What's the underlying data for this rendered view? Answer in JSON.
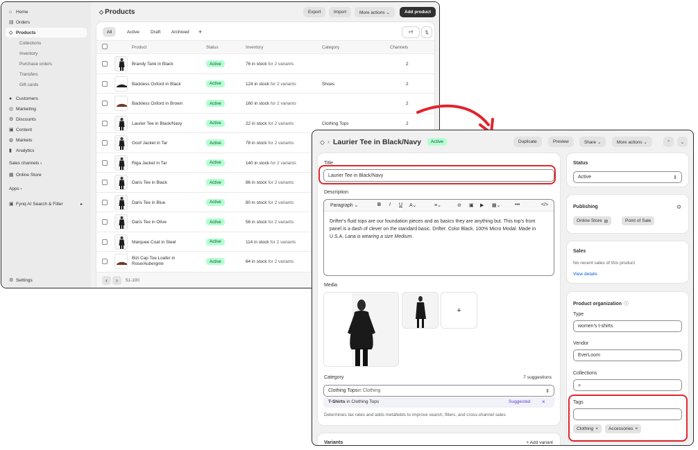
{
  "sidebar": {
    "items": [
      {
        "label": "Home",
        "icon": "home-icon",
        "glyph": "⌂"
      },
      {
        "label": "Orders",
        "icon": "orders-icon",
        "glyph": "▤"
      },
      {
        "label": "Products",
        "icon": "tag-icon",
        "glyph": "◇"
      }
    ],
    "sub_items": [
      "Collections",
      "Inventory",
      "Purchase orders",
      "Transfers",
      "Gift cards"
    ],
    "items2": [
      {
        "label": "Customers",
        "icon": "person-icon",
        "glyph": "●"
      },
      {
        "label": "Marketing",
        "icon": "target-icon",
        "glyph": "◎"
      },
      {
        "label": "Discounts",
        "icon": "discount-icon",
        "glyph": "⚙"
      },
      {
        "label": "Content",
        "icon": "content-icon",
        "glyph": "▣"
      },
      {
        "label": "Markets",
        "icon": "globe-icon",
        "glyph": "◍"
      },
      {
        "label": "Analytics",
        "icon": "analytics-icon",
        "glyph": "▮"
      }
    ],
    "sales_channels": "Sales channels ›",
    "online_store": "Online Store",
    "apps": "Apps ›",
    "app_item": "Fynq AI Search & Filter",
    "settings": "Settings"
  },
  "products_page": {
    "title": "Products",
    "buttons": {
      "export": "Export",
      "import": "Import",
      "more_actions": "More actions ⌄",
      "add_product": "Add product"
    },
    "tabs": [
      "All",
      "Active",
      "Draft",
      "Archived",
      "+"
    ],
    "columns": {
      "product": "Product",
      "status": "Status",
      "inventory": "Inventory",
      "category": "Category",
      "channels": "Channels"
    },
    "rows": [
      {
        "name": "Brandy Tank in Black",
        "status": "Active",
        "stock": "76 in stock",
        "variants": " for 2 variants",
        "category": "",
        "channels": "2"
      },
      {
        "name": "Backless Oxford in Black",
        "status": "Active",
        "stock": "124 in stock",
        "variants": " for 2 variants",
        "category": "Shoes",
        "channels": "2"
      },
      {
        "name": "Backless Oxford in Brown",
        "status": "Active",
        "stock": "160 in stock",
        "variants": " for 2 variants",
        "category": "",
        "channels": "2"
      },
      {
        "name": "Laurier Tee in Black/Navy",
        "status": "Active",
        "stock": "22 in stock",
        "variants": " for 2 variants",
        "category": "Clothing Tops",
        "channels": "2"
      },
      {
        "name": "Goof Jacket in Tar",
        "status": "Active",
        "stock": "78 in stock",
        "variants": " for 2 variants",
        "category": "",
        "channels": ""
      },
      {
        "name": "Riga Jacket in Tar",
        "status": "Active",
        "stock": "140 in stock",
        "variants": " for 2 variants",
        "category": "",
        "channels": ""
      },
      {
        "name": "Daris Tee in Black",
        "status": "Active",
        "stock": "86 in stock",
        "variants": " for 2 variants",
        "category": "",
        "channels": ""
      },
      {
        "name": "Daris Tee in Blue",
        "status": "Active",
        "stock": "80 in stock",
        "variants": " for 2 variants",
        "category": "",
        "channels": ""
      },
      {
        "name": "Daris Tee in Olive",
        "status": "Active",
        "stock": "56 in stock",
        "variants": " for 2 variants",
        "category": "",
        "channels": ""
      },
      {
        "name": "Marquee Coat in Steel",
        "status": "Active",
        "stock": "114 in stock",
        "variants": " for 2 variants",
        "category": "",
        "channels": ""
      },
      {
        "name": "Bizi Cap Toe Loafer in Rose/Aubergine",
        "status": "Active",
        "stock": "64 in stock",
        "variants": " for 2 variants",
        "category": "",
        "channels": ""
      }
    ],
    "pagination": "51-100"
  },
  "detail": {
    "title": "Laurier Tee in Black/Navy",
    "status_badge": "Active",
    "buttons": {
      "duplicate": "Duplicate",
      "preview": "Preview",
      "share": "Share ⌄",
      "more_actions": "More actions ⌄"
    },
    "title_label": "Title",
    "title_value": "Laurier Tee in Black/Navy",
    "description_label": "Description",
    "toolbar": {
      "paragraph": "Paragraph ⌄"
    },
    "description_text": "Drifter's fluid tops are our foundation pieces and as basics they are anything but. This top's front panel is a dash of clever on the standard basic. Drifter. Color Black. 100% Micro Modal. Made in U.S.A. ",
    "description_italic": "Lana is wearing a size Medium.",
    "media_label": "Media",
    "add_media": "+",
    "category_label": "Category",
    "suggestions": "7 suggestions",
    "category_value": "Clothing Tops",
    "category_value_suffix": " in Clothing",
    "suggestion_name": "T-Shirts",
    "suggestion_suffix": " in Clothing Tops",
    "suggested_tag": "Suggested",
    "category_help": "Determines tax rates and adds metafields to improve search, filters, and cross-channel sales",
    "variants_label": "Variants",
    "add_variant": "+ Add variant",
    "status_card": {
      "label": "Status",
      "value": "Active"
    },
    "publishing": {
      "label": "Publishing",
      "channels": [
        "Online Store",
        "Point of Sale"
      ]
    },
    "sales": {
      "label": "Sales",
      "text": "No recent sales of this product",
      "link": "View details"
    },
    "organization": {
      "label": "Product organization",
      "type_label": "Type",
      "type_value": "women's t-shirts",
      "vendor_label": "Vendor",
      "vendor_value": "EverLoom",
      "collections_label": "Collections",
      "tags_label": "Tags",
      "tags": [
        "Clothing",
        "Accessories"
      ]
    }
  },
  "colors": {
    "accent_red": "#e0252d",
    "active_green_bg": "#b4fed2",
    "primary_dark": "#303030"
  }
}
